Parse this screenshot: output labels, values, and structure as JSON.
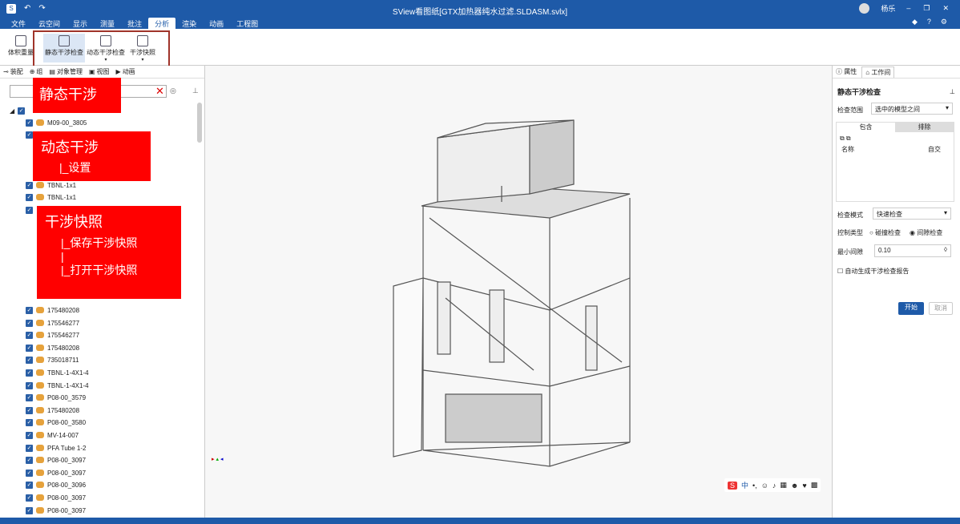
{
  "window": {
    "title": "SView看图纸[GTX加热器纯水过滤.SLDASM.svlx]",
    "user": "杨乐",
    "app_icon": "view-icon"
  },
  "menus": [
    "文件",
    "云空间",
    "显示",
    "测量",
    "批注",
    "分析",
    "渲染",
    "动画",
    "工程图"
  ],
  "ribbon": {
    "volume": "体积重量",
    "static": "静态干涉检查",
    "dynamic": "动态干涉检查",
    "snapshot": "干涉快照"
  },
  "left": {
    "tabs": [
      "装配",
      "组",
      "对象管理",
      "视图",
      "动画"
    ],
    "items": [
      "M09-00_3805",
      "TBNL-1x1",
      "TBNL-1x1",
      "175480208",
      "175546277",
      "175546277",
      "175480208",
      "735018711",
      "TBNL-1-4X1-4",
      "TBNL-1-4X1-4",
      "P08-00_3579",
      "175480208",
      "P08-00_3580",
      "MV-14-007",
      "PFA Tube 1-2",
      "P08-00_3097",
      "P08-00_3097",
      "P08-00_3096",
      "P08-00_3097",
      "P08-00_3097"
    ]
  },
  "overlays": {
    "static": "静态干涉",
    "dynamic": "动态干涉",
    "dynamic_sub": "|_设置",
    "snapshot": "干涉快照",
    "snap_1": "|_保存干涉快照",
    "snap_sep": "|",
    "snap_2": "|_打开干涉快照"
  },
  "right": {
    "tab_props": "属性",
    "tab_workspace": "工作间",
    "title": "静态干涉检查",
    "range_label": "检查范围",
    "range_value": "选中的模型之间",
    "include": "包含",
    "exclude": "排除",
    "col_name": "名称",
    "col_self": "自交",
    "mode_label": "检查模式",
    "mode_value": "快速检查",
    "ctrl_label": "控制类型",
    "opt_collision": "碰撞检查",
    "opt_gap": "间隙检查",
    "gap_label": "最小间隙",
    "gap_value": "0.10",
    "auto_report": "自动生成干涉检查报告",
    "start": "开始",
    "cancel": "取消"
  },
  "ime": {
    "lang": "中"
  }
}
